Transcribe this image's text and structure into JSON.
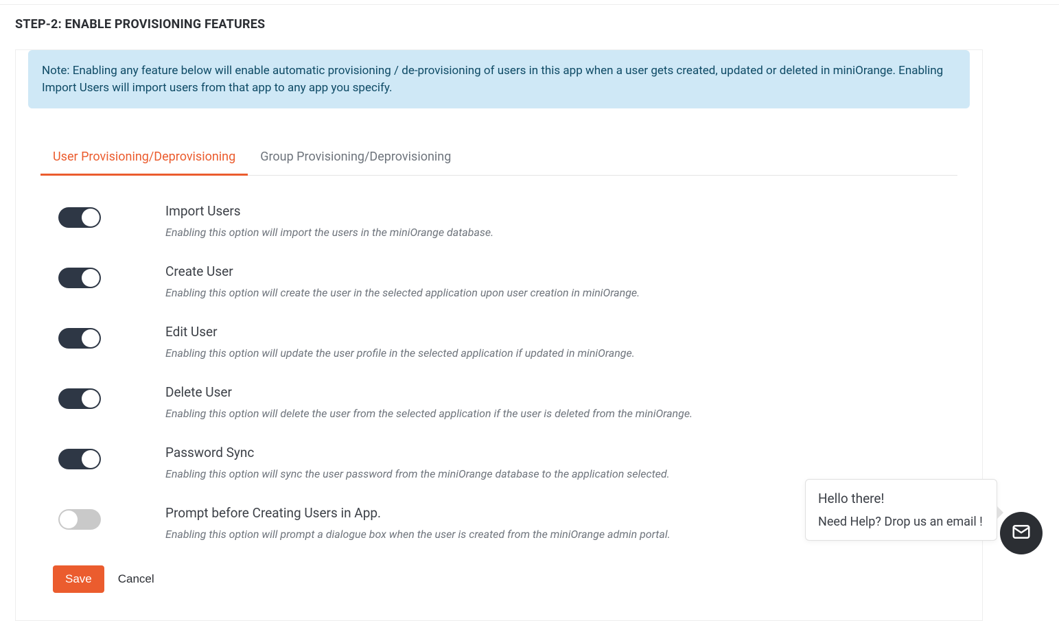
{
  "step_title": "STEP-2: ENABLE PROVISIONING FEATURES",
  "note": "Note: Enabling any feature below will enable automatic provisioning / de-provisioning of users in this app when a user gets created, updated or deleted in miniOrange. Enabling Import Users will import users from that app to any app you specify.",
  "tabs": {
    "user": "User Provisioning/Deprovisioning",
    "group": "Group Provisioning/Deprovisioning"
  },
  "features": [
    {
      "id": "import-users",
      "title": "Import Users",
      "desc": "Enabling this option will import the users in the miniOrange database.",
      "on": true
    },
    {
      "id": "create-user",
      "title": "Create User",
      "desc": "Enabling this option will create the user in the selected application upon user creation in miniOrange.",
      "on": true
    },
    {
      "id": "edit-user",
      "title": "Edit User",
      "desc": "Enabling this option will update the user profile in the selected application if updated in miniOrange.",
      "on": true
    },
    {
      "id": "delete-user",
      "title": "Delete User",
      "desc": "Enabling this option will delete the user from the selected application if the user is deleted from the miniOrange.",
      "on": true
    },
    {
      "id": "password-sync",
      "title": "Password Sync",
      "desc": "Enabling this option will sync the user password from the miniOrange database to the application selected.",
      "on": true
    },
    {
      "id": "prompt-create",
      "title": "Prompt before Creating Users in App.",
      "desc": "Enabling this option will prompt a dialogue box when the user is created from the miniOrange admin portal.",
      "on": false
    }
  ],
  "actions": {
    "save": "Save",
    "cancel": "Cancel"
  },
  "chat": {
    "line1": "Hello there!",
    "line2": "Need Help? Drop us an email !"
  }
}
